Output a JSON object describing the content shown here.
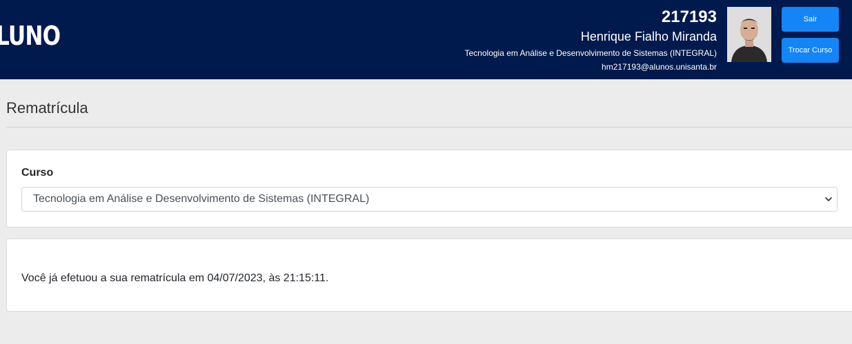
{
  "header": {
    "logo_text": "LUNO",
    "ra": "217193",
    "name": "Henrique Fialho Miranda",
    "course": "Tecnologia em Análise e Desenvolvimento de Sistemas (INTEGRAL)",
    "email": "hm217193@alunos.unisanta.br",
    "logout_label": "Sair",
    "change_course_label": "Trocar Curso"
  },
  "page": {
    "title": "Rematrícula"
  },
  "course_card": {
    "label": "Curso",
    "selected": "Tecnologia em Análise e Desenvolvimento de Sistemas (INTEGRAL)"
  },
  "message_card": {
    "text": "Você já efetuou a sua rematrícula em 04/07/2023, às 21:15:11."
  },
  "colors": {
    "header_bg": "#001a4d",
    "button_bg": "#1485f7",
    "page_bg": "#ececec"
  }
}
